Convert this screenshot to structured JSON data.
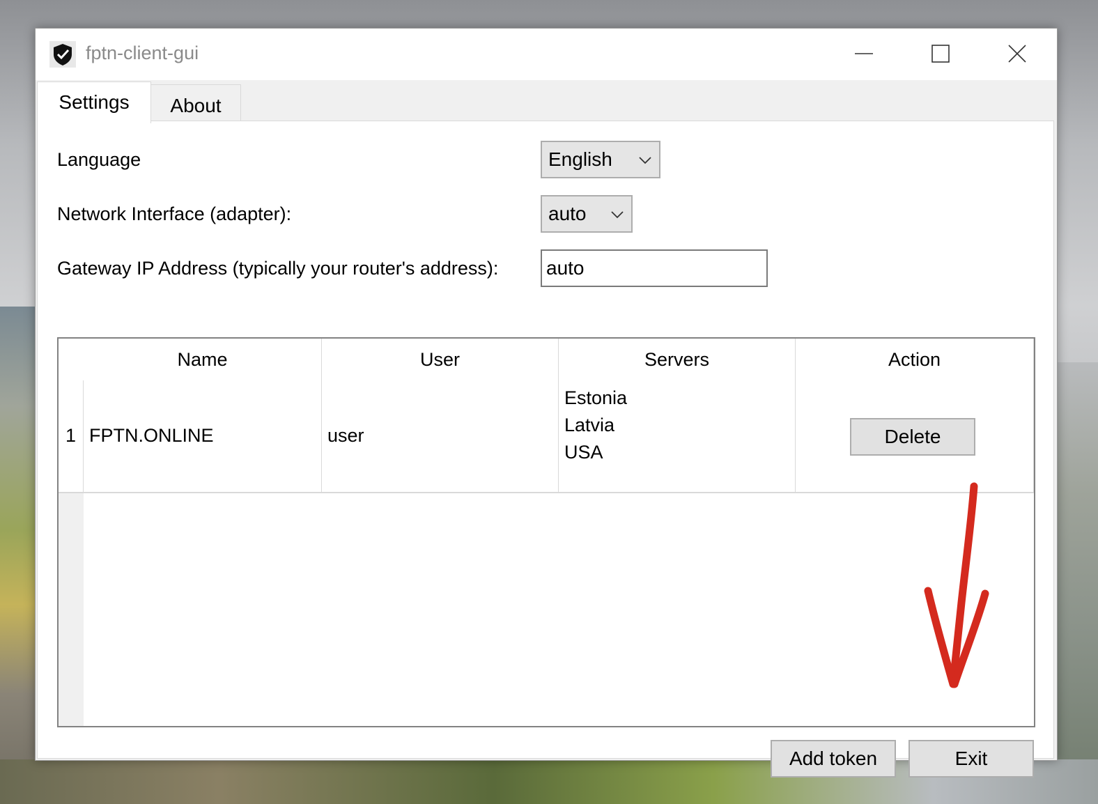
{
  "window": {
    "title": "fptn-client-gui",
    "icon": "shield-icon",
    "controls": [
      "minimize-icon",
      "maximize-icon",
      "close-icon"
    ]
  },
  "tabs": [
    {
      "label": "Settings",
      "active": true
    },
    {
      "label": "About",
      "active": false
    }
  ],
  "settings": {
    "language": {
      "label": "Language",
      "value": "English"
    },
    "network_interface": {
      "label": "Network Interface (adapter):",
      "value": "auto"
    },
    "gateway": {
      "label": "Gateway IP Address (typically your router's address):",
      "value": "auto"
    }
  },
  "tokens_table": {
    "columns": [
      "Name",
      "User",
      "Servers",
      "Action"
    ],
    "rows": [
      {
        "index": "1",
        "name": "FPTN.ONLINE",
        "user": "user",
        "servers": [
          "Estonia",
          "Latvia",
          "USA"
        ],
        "action_label": "Delete"
      }
    ]
  },
  "footer": {
    "add_token_label": "Add token",
    "exit_label": "Exit"
  },
  "annotation": {
    "type": "hand-drawn-arrow",
    "color": "#d42a1e",
    "points_to": "exit-button"
  }
}
